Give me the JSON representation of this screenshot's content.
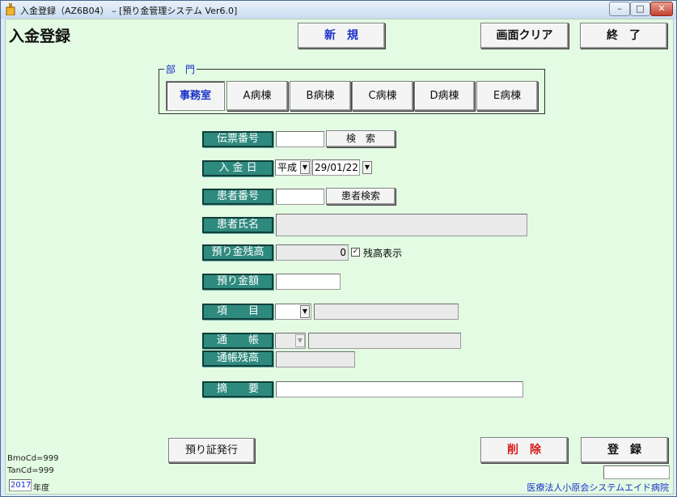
{
  "window": {
    "title": "入金登録（AZ6B04） – [預り金管理システム Ver6.0]",
    "minimize": "–",
    "maximize": "□",
    "close": "✕"
  },
  "header": {
    "page_title": "入金登録",
    "new_button": "新　規",
    "clear_button": "画面クリア",
    "exit_button": "終　了"
  },
  "department": {
    "legend": "部　門",
    "items": [
      "事務室",
      "A病棟",
      "B病棟",
      "C病棟",
      "D病棟",
      "E病棟"
    ],
    "selected_index": 0
  },
  "form": {
    "voucher_no": {
      "label": "伝票番号",
      "value": "",
      "search_button": "検　索"
    },
    "deposit_date": {
      "label": "入 金 日",
      "era": "平成",
      "date": "29/01/22"
    },
    "patient_no": {
      "label": "患者番号",
      "value": "",
      "search_button": "患者検索"
    },
    "patient_name": {
      "label": "患者氏名",
      "value": ""
    },
    "deposit_balance": {
      "label": "預り金残高",
      "value": "0",
      "show_balance_label": "残高表示",
      "show_balance_checked": true
    },
    "deposit_amount": {
      "label": "預り金額",
      "value": ""
    },
    "item": {
      "label": "項　　目",
      "code": "",
      "name": ""
    },
    "passbook": {
      "label": "通　　帳",
      "code": "",
      "name": ""
    },
    "passbook_balance": {
      "label": "通帳残高",
      "value": ""
    },
    "summary": {
      "label": "摘　　要",
      "value": ""
    }
  },
  "footer": {
    "receipt_button": "預り証発行",
    "delete_button": "削　除",
    "register_button": "登　録",
    "bmo_cd": "BmoCd=999",
    "tan_cd": "TanCd=999",
    "fiscal_year": "2017",
    "fiscal_year_label": "年度",
    "hospital_name": "医療法人小原会システムエイド病院"
  },
  "colors": {
    "client_bg": "#e3fae3",
    "label_bg": "#2e8a7e",
    "selected_text": "#1a32c8",
    "delete_text": "#d81818",
    "hospital_text": "#1a32c8"
  }
}
